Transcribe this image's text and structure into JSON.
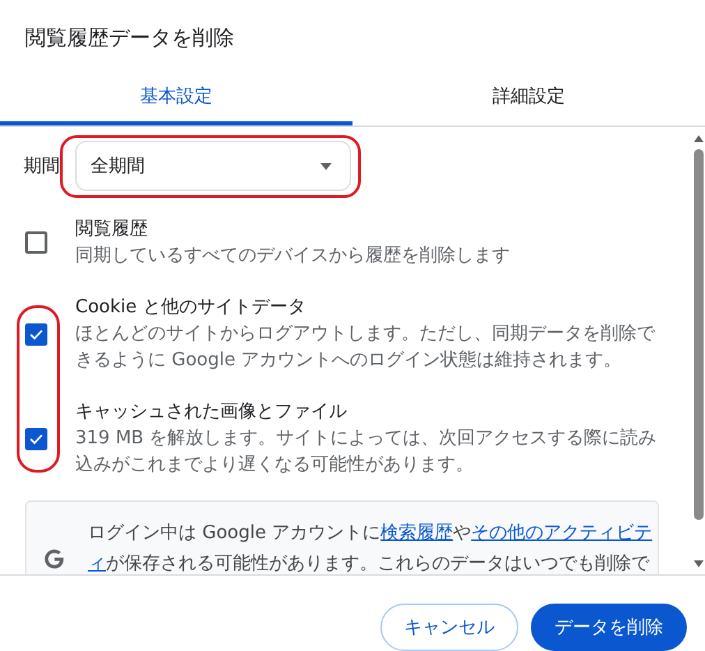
{
  "dialog": {
    "title": "閲覧履歴データを削除"
  },
  "tabs": [
    {
      "label": "基本設定",
      "selected": true
    },
    {
      "label": "詳細設定",
      "selected": false
    }
  ],
  "period": {
    "label": "期間",
    "value": "全期間",
    "highlighted": true
  },
  "options": [
    {
      "title": "閲覧履歴",
      "checked": false,
      "description": [
        "同期しているすべてのデバイスから履歴を削除します"
      ]
    },
    {
      "title": "Cookie と他のサイトデータ",
      "checked": true,
      "description": [
        "ほとんどのサイトからログアウトします。ただし、同期データを削除で",
        "きるように Google アカウントへのログイン状態は維持されます。"
      ]
    },
    {
      "title": "キャッシュされた画像とファイル",
      "checked": true,
      "description": [
        "319 MB を解放します。サイトによっては、次回アクセスする際に読み",
        "込みがこれまでより遅くなる可能性があります。"
      ]
    }
  ],
  "options_highlighted": true,
  "info": {
    "lines": [
      [
        {
          "kind": "text",
          "text": "ログイン中は Google アカウントに"
        },
        {
          "kind": "link",
          "text": "検索履歴"
        },
        {
          "kind": "text",
          "text": "や"
        },
        {
          "kind": "link",
          "text": "その他のアクティビテ"
        }
      ],
      [
        {
          "kind": "link",
          "text": "ィ"
        },
        {
          "kind": "text",
          "text": "が保存される可能性があります。これらのデータはいつでも削除で"
        }
      ]
    ]
  },
  "buttons": [
    {
      "label": "キャンセル",
      "kind": "secondary"
    },
    {
      "label": "データを削除",
      "kind": "primary"
    }
  ]
}
